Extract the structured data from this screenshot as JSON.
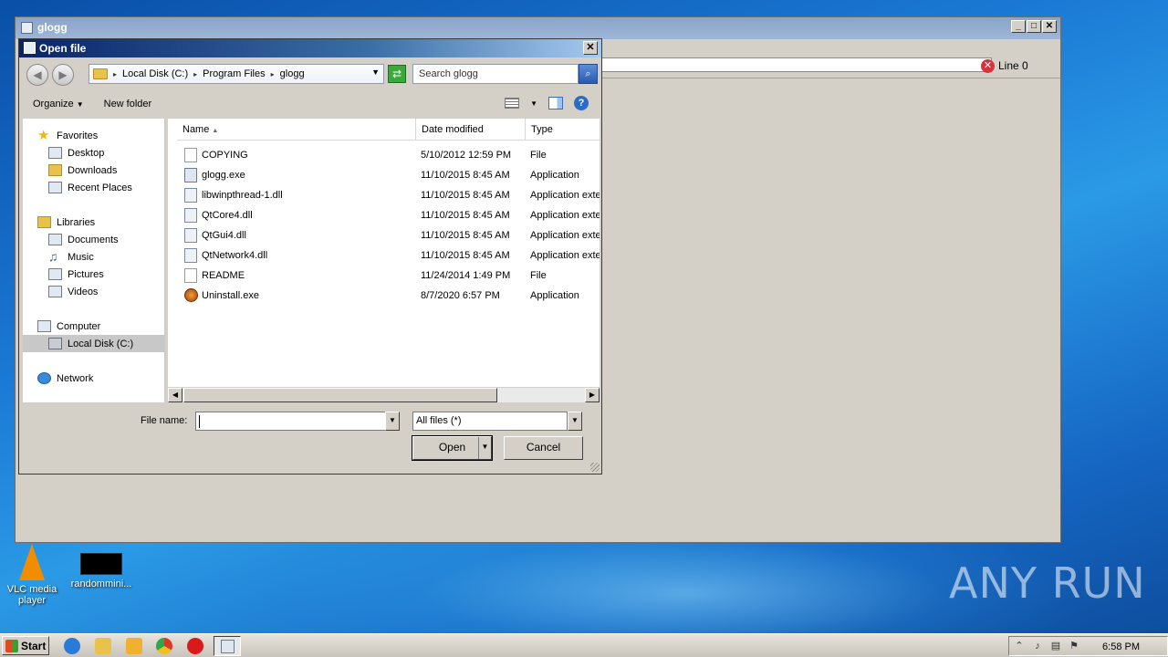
{
  "desktop": {
    "icons": [
      {
        "label": "VLC media player",
        "icon": "vlc-icon"
      },
      {
        "label": "randommini...",
        "icon": "app-thumbnail-icon"
      }
    ],
    "watermark": "ANY RUN"
  },
  "main_window": {
    "title": "glogg",
    "caption_buttons": [
      "_",
      "□",
      "✕"
    ],
    "status": {
      "icon": "error-icon",
      "text": "Line 0"
    }
  },
  "dialog": {
    "title": "Open file",
    "close_label": "✕",
    "breadcrumb": [
      "Local Disk (C:)",
      "Program Files",
      "glogg"
    ],
    "search_placeholder": "Search glogg",
    "toolbar": {
      "organize": "Organize",
      "new_folder": "New folder"
    },
    "nav": {
      "favorites": "Favorites",
      "favorites_items": [
        "Desktop",
        "Downloads",
        "Recent Places"
      ],
      "libraries": "Libraries",
      "libraries_items": [
        "Documents",
        "Music",
        "Pictures",
        "Videos"
      ],
      "computer": "Computer",
      "computer_items": [
        "Local Disk (C:)"
      ],
      "network": "Network"
    },
    "columns": {
      "name": "Name",
      "date": "Date modified",
      "type": "Type"
    },
    "files": [
      {
        "name": "COPYING",
        "date": "5/10/2012 12:59 PM",
        "type": "File",
        "icon": "file-icon"
      },
      {
        "name": "glogg.exe",
        "date": "11/10/2015 8:45 AM",
        "type": "Application",
        "icon": "exe-icon"
      },
      {
        "name": "libwinpthread-1.dll",
        "date": "11/10/2015 8:45 AM",
        "type": "Application exte",
        "icon": "dll-icon"
      },
      {
        "name": "QtCore4.dll",
        "date": "11/10/2015 8:45 AM",
        "type": "Application exte",
        "icon": "dll-icon"
      },
      {
        "name": "QtGui4.dll",
        "date": "11/10/2015 8:45 AM",
        "type": "Application exte",
        "icon": "dll-icon"
      },
      {
        "name": "QtNetwork4.dll",
        "date": "11/10/2015 8:45 AM",
        "type": "Application exte",
        "icon": "dll-icon"
      },
      {
        "name": "README",
        "date": "11/24/2014 1:49 PM",
        "type": "File",
        "icon": "file-icon"
      },
      {
        "name": "Uninstall.exe",
        "date": "8/7/2020 6:57 PM",
        "type": "Application",
        "icon": "uninstaller-icon"
      }
    ],
    "file_name_label": "File name:",
    "file_name_value": "",
    "file_type": "All files (*)",
    "open_label": "Open",
    "cancel_label": "Cancel"
  },
  "taskbar": {
    "start_label": "Start",
    "clock": "6:58 PM"
  }
}
